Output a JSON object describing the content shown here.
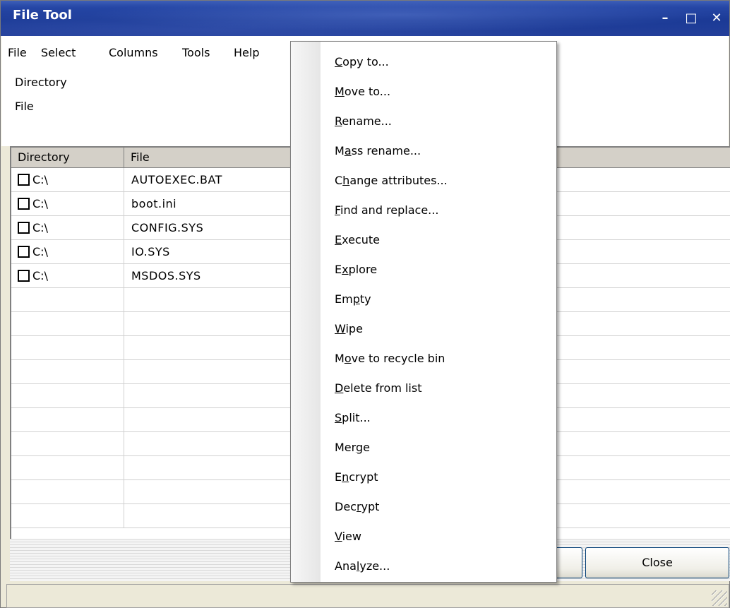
{
  "window": {
    "title": "File Tool",
    "minimize": "–",
    "maximize": "□",
    "close": "✕"
  },
  "menubar": [
    "File",
    "Select",
    "Columns",
    "Tools",
    "Help"
  ],
  "info": {
    "line1": "Directory",
    "line2": "File"
  },
  "grid": {
    "columns": [
      "Directory",
      "File"
    ],
    "rows": [
      {
        "dir": "C:\\",
        "file": "AUTOEXEC.BAT"
      },
      {
        "dir": "C:\\",
        "file": "boot.ini"
      },
      {
        "dir": "C:\\",
        "file": "CONFIG.SYS"
      },
      {
        "dir": "C:\\",
        "file": "IO.SYS"
      },
      {
        "dir": "C:\\",
        "file": "MSDOS.SYS"
      }
    ]
  },
  "buttons": {
    "close": "Close"
  },
  "context_menu": [
    {
      "pre": "",
      "key": "C",
      "post": "opy to..."
    },
    {
      "pre": "",
      "key": "M",
      "post": "ove to..."
    },
    {
      "pre": "",
      "key": "R",
      "post": "ename..."
    },
    {
      "pre": "M",
      "key": "a",
      "post": "ss rename..."
    },
    {
      "pre": "C",
      "key": "h",
      "post": "ange attributes..."
    },
    {
      "pre": "",
      "key": "F",
      "post": "ind and replace..."
    },
    {
      "pre": "",
      "key": "E",
      "post": "xecute"
    },
    {
      "pre": "E",
      "key": "x",
      "post": "plore"
    },
    {
      "pre": "Em",
      "key": "p",
      "post": "ty"
    },
    {
      "pre": "",
      "key": "W",
      "post": "ipe"
    },
    {
      "pre": "M",
      "key": "o",
      "post": "ve to recycle bin"
    },
    {
      "pre": "",
      "key": "D",
      "post": "elete from list"
    },
    {
      "pre": "",
      "key": "S",
      "post": "plit..."
    },
    {
      "pre": "Mer",
      "key": "g",
      "post": "e"
    },
    {
      "pre": "E",
      "key": "n",
      "post": "crypt"
    },
    {
      "pre": "Dec",
      "key": "r",
      "post": "ypt"
    },
    {
      "pre": "",
      "key": "V",
      "post": "iew"
    },
    {
      "pre": "Ana",
      "key": "l",
      "post": "yze..."
    }
  ],
  "colors": {
    "titlebar": "#1b3a96",
    "face": "#ece9d8",
    "grid_header": "#d4d0c8"
  }
}
